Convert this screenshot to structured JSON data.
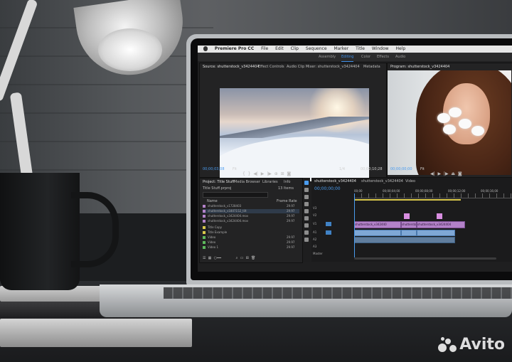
{
  "menubar": {
    "app_name": "Premiere Pro CC",
    "items": [
      "File",
      "Edit",
      "Clip",
      "Sequence",
      "Marker",
      "Title",
      "Window",
      "Help"
    ]
  },
  "workspaces": {
    "items": [
      "Assembly",
      "Editing",
      "Color",
      "Effects",
      "Audio"
    ],
    "active": "Editing"
  },
  "source_monitor": {
    "tabs": [
      "Source: shutterstock_v3424404",
      "Effect Controls",
      "Audio Clip Mixer: shutterstock_v3424404",
      "Metadata"
    ],
    "timecode_in": "00;00;03;08",
    "timecode_out": "00;00;10;28",
    "zoom": "Fit",
    "scale": "1/4"
  },
  "program_monitor": {
    "tab": "Program: shutterstock_v3424404",
    "timecode": "00;00;00;00",
    "zoom": "Fit"
  },
  "project_panel": {
    "tabs": [
      "Project: Title Stuff",
      "Media Browser",
      "Libraries",
      "Info"
    ],
    "project_name": "Title Stuff.prproj",
    "item_count": "13 Items",
    "column_name": "Name",
    "column_rate": "Frame Rate",
    "items": [
      {
        "name": "shutterstock_v1728403",
        "rate": "29.97"
      },
      {
        "name": "shutterstock_v1807152_tilt",
        "rate": "29.97"
      },
      {
        "name": "shutterstock_v3424404.mov",
        "rate": "29.97"
      },
      {
        "name": "shutterstock_v3424404.mov",
        "rate": "29.97"
      },
      {
        "name": "Title Copy",
        "rate": ""
      },
      {
        "name": "Title Example",
        "rate": ""
      },
      {
        "name": "Video",
        "rate": "29.97"
      },
      {
        "name": "Video",
        "rate": "29.97"
      },
      {
        "name": "Video 1",
        "rate": "29.97"
      }
    ]
  },
  "timeline": {
    "tabs": [
      "shutterstock_v3424404",
      "shutterstock_v3424404",
      "Video"
    ],
    "timecode": "00;00;00;00",
    "ruler_labels": [
      "00;00",
      "00;00;04;00",
      "00;00;08;00",
      "00;00;12;00",
      "00;00;16;00"
    ],
    "tracks": [
      "V3",
      "V2",
      "V1",
      "A1",
      "A2",
      "A3",
      "Master"
    ],
    "clips": [
      "shutterstock_v342440",
      "shuttersto",
      "shutterstock_v3424404"
    ]
  },
  "watermark": {
    "text": "Avito"
  },
  "colors": {
    "accent_blue": "#4a9cf0",
    "video_clip": "#b382c9",
    "audio_clip": "#7fa8d6"
  }
}
